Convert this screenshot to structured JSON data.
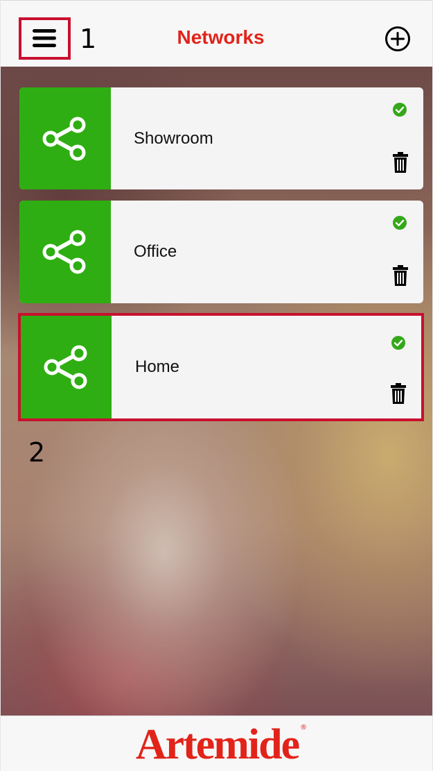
{
  "header": {
    "title": "Networks",
    "menu_icon": "hamburger-menu-icon",
    "add_icon": "plus-circle-icon",
    "annotation_1": "1"
  },
  "networks": [
    {
      "name": "Showroom",
      "status_icon": "check-circle-icon",
      "status_color": "#34a81a",
      "delete_icon": "trash-icon"
    },
    {
      "name": "Office",
      "status_icon": "check-circle-icon",
      "status_color": "#34a81a",
      "delete_icon": "trash-icon"
    },
    {
      "name": "Home",
      "status_icon": "check-circle-icon",
      "status_color": "#34a81a",
      "delete_icon": "trash-icon"
    }
  ],
  "annotation_2": "2",
  "footer": {
    "brand": "Artemide",
    "reg_mark": "®"
  },
  "colors": {
    "accent": "#e2231a",
    "network_tile": "#2eae12",
    "highlight": "#c8102e"
  }
}
